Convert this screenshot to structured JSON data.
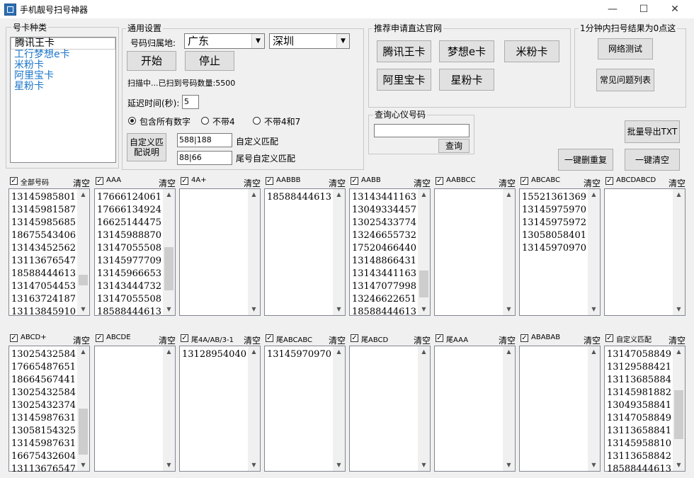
{
  "window": {
    "title": "手机靓号扫号神器",
    "min": "—",
    "max": "☐",
    "close": "✕"
  },
  "card_types": {
    "legend": "号卡种类",
    "items": [
      "腾讯王卡",
      "工行梦想e卡",
      "米粉卡",
      "阿里宝卡",
      "星粉卡"
    ]
  },
  "settings": {
    "legend": "通用设置",
    "region_label": "号码归属地:",
    "province": "广东",
    "city": "深圳",
    "start_button": "开始",
    "stop_button": "停止",
    "status": "扫描中...已扫到号码数量:5500",
    "delay_label": "延迟时间(秒):",
    "delay_value": "5",
    "radio_all": "包含所有数字",
    "radio_no4": "不带4",
    "radio_no47": "不带4和7",
    "custom_desc_button": "自定义匹配说明",
    "custom_match_value": "588|188",
    "custom_match_label": "自定义匹配",
    "tail_match_value": "88|66",
    "tail_match_label": "尾号自定义匹配"
  },
  "recommend": {
    "legend": "推荐申请直达官网",
    "buttons": [
      "腾讯王卡",
      "梦想e卡",
      "米粉卡",
      "阿里宝卡",
      "星粉卡"
    ]
  },
  "help": {
    "legend": "1分钟内扫号结果为0点这",
    "network_test": "网络测试",
    "faq": "常见问题列表"
  },
  "query": {
    "legend": "查询心仪号码",
    "input_value": "",
    "query_button": "查询"
  },
  "actions": {
    "export": "批量导出TXT",
    "dedupe": "一键删重复",
    "clear_all": "一键清空"
  },
  "clear_label": "清空",
  "panels": [
    {
      "title": "全部号码",
      "checked": true,
      "numbers": [
        "13145985801",
        "13145981587",
        "13145985685",
        "18675543406",
        "13143452562",
        "13113676547",
        "18588444613",
        "13147054453",
        "13163724187",
        "13113845910"
      ],
      "thumb": [
        0.72,
        0.1
      ]
    },
    {
      "title": "AAA",
      "checked": true,
      "numbers": [
        "17666124061",
        "17666134924",
        "16625144475",
        "13145988870",
        "13147055508",
        "13145977709",
        "13145966653",
        "13143444732",
        "13147055508",
        "18588444613"
      ],
      "thumb": [
        0.45,
        0.42
      ]
    },
    {
      "title": "4A+",
      "checked": true,
      "numbers": [],
      "thumb": null
    },
    {
      "title": "AABBB",
      "checked": true,
      "numbers": [
        "18588444613"
      ],
      "thumb": null
    },
    {
      "title": "AABB",
      "checked": true,
      "numbers": [
        "13143441163",
        "13049334457",
        "13025433774",
        "13246655732",
        "17520466440",
        "13148866431",
        "13143441163",
        "13147077998",
        "13246622651",
        "18588444613"
      ],
      "thumb": [
        0.68,
        0.26
      ]
    },
    {
      "title": "AABBCC",
      "checked": true,
      "numbers": [],
      "thumb": null
    },
    {
      "title": "ABCABC",
      "checked": true,
      "numbers": [
        "15521361369",
        "13145975970",
        "13145975972",
        "13058058401",
        "13145970970"
      ],
      "thumb": null
    },
    {
      "title": "ABCDABCD",
      "checked": true,
      "numbers": [],
      "thumb": null
    },
    {
      "title": "ABCD+",
      "checked": true,
      "numbers": [
        "13025432584",
        "17665487651",
        "18664567441",
        "13025432584",
        "13025432374",
        "13145987631",
        "13058154325",
        "13145987631",
        "16675432604",
        "13113676547"
      ],
      "thumb": [
        0.5,
        0.45
      ]
    },
    {
      "title": "ABCDE",
      "checked": true,
      "numbers": [],
      "thumb": null
    },
    {
      "title": "尾4A/AB/3-1",
      "checked": true,
      "numbers": [
        "13128954040"
      ],
      "thumb": null
    },
    {
      "title": "尾ABCABC",
      "checked": true,
      "numbers": [
        "13145970970"
      ],
      "thumb": null
    },
    {
      "title": "尾ABCD",
      "checked": true,
      "numbers": [],
      "thumb": null
    },
    {
      "title": "尾AAA",
      "checked": true,
      "numbers": [],
      "thumb": null
    },
    {
      "title": "ABABAB",
      "checked": true,
      "numbers": [],
      "thumb": null
    },
    {
      "title": "自定义匹配",
      "checked": true,
      "numbers": [
        "13147058849",
        "13129588421",
        "13113685884",
        "13145981882",
        "13049358841",
        "13147058849",
        "13113658841",
        "13145958810",
        "13113658842",
        "18588444613"
      ],
      "thumb": [
        0.32,
        0.48
      ]
    }
  ]
}
